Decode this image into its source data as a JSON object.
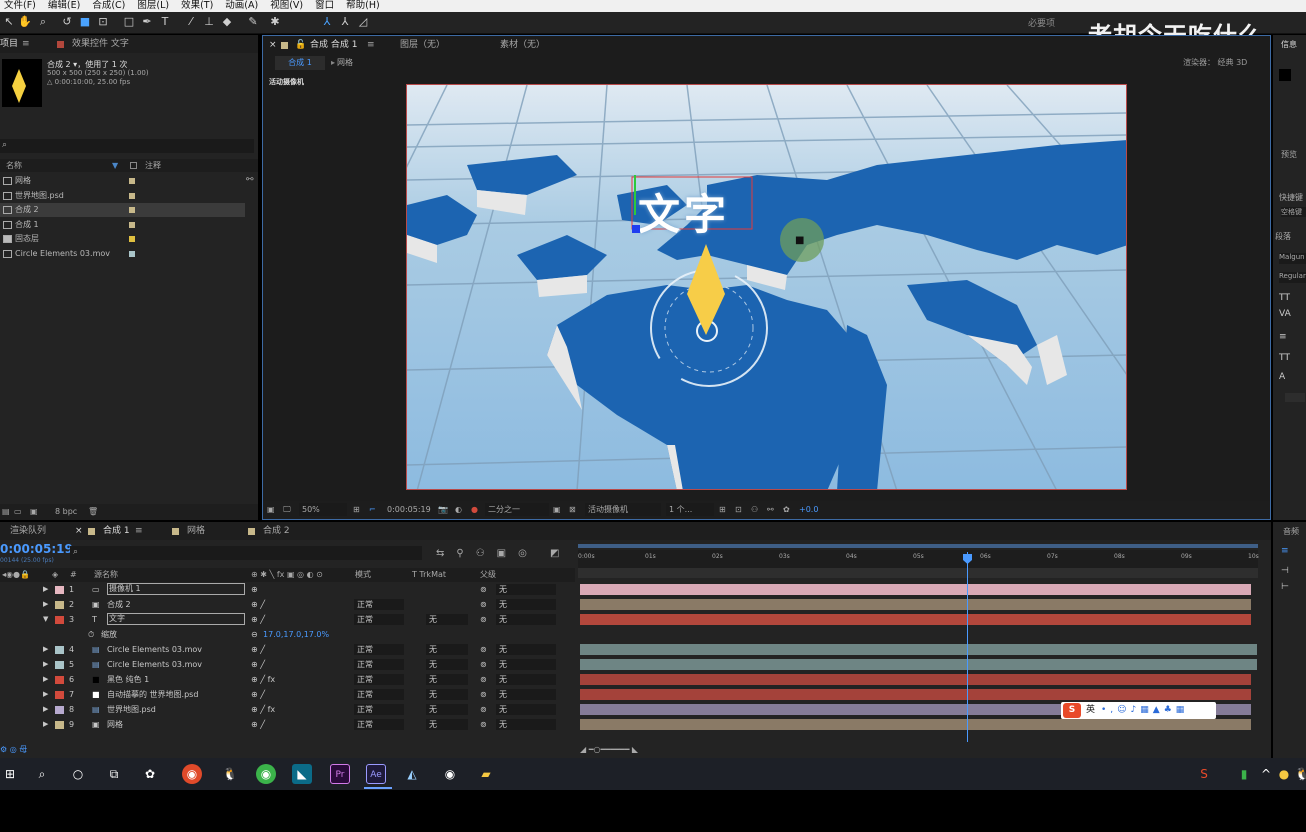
{
  "menu": [
    "文件(F)",
    "编辑(E)",
    "合成(C)",
    "图层(L)",
    "效果(T)",
    "动画(A)",
    "视图(V)",
    "窗口",
    "帮助(H)"
  ],
  "toolbar": {
    "workspace": "必要项",
    "icons": [
      "arrow-icon",
      "hand-icon",
      "zoom-icon",
      "rotate-icon",
      "camera-icon",
      "pan-behind-icon",
      "rect-icon",
      "pen-icon",
      "type-icon",
      "brush-icon",
      "stamp-icon",
      "eraser-icon",
      "roto-icon",
      "puppet-icon"
    ]
  },
  "watermark": "老胡今天吃什么",
  "project": {
    "tab_project": "项目",
    "tab_effects": "效果控件 文字",
    "comp_name": "合成 2 ▾，使用了 1 次",
    "comp_size": "500 x 500 (250 x 250) (1.00)",
    "comp_dur": "△ 0:00:10:00, 25.00 fps",
    "col_name": "名称",
    "col_note": "注释",
    "bpc": "8 bpc",
    "items": [
      {
        "name": "网格",
        "color": "#c7b88a",
        "icon": "comp"
      },
      {
        "name": "世界地图.psd",
        "color": "#c7b88a",
        "icon": "file"
      },
      {
        "name": "合成 2",
        "color": "#c7b88a",
        "icon": "comp"
      },
      {
        "name": "合成 1",
        "color": "#c7b88a",
        "icon": "comp"
      },
      {
        "name": "固态层",
        "color": "#e0c040",
        "icon": "folder"
      },
      {
        "name": "Circle Elements 03.mov",
        "color": "#a9c4c8",
        "icon": "file"
      }
    ]
  },
  "viewer": {
    "tab_comp": "合成 合成 1",
    "tab_layer": "图层（无）",
    "tab_footage": "素材（无）",
    "sub_tab1": "合成 1",
    "sub_tab2": "网格",
    "renderer": "渲染器：  经典 3D",
    "camera_label": "活动摄像机",
    "overlay_text": "文字",
    "zoom": "50%",
    "timecode": "0:00:05:19",
    "resolution": "二分之一",
    "camera_view": "活动摄像机",
    "views": "1 个...",
    "exposure": "+0.0"
  },
  "timeline": {
    "tab_render": "渲染队列",
    "tab_comp1": "合成 1",
    "tab_grid": "网格",
    "tab_comp2": "合成 2",
    "timecode": "0:00:05:19",
    "frame_info": "00144 (25.00 fps)",
    "col_source": "源名称",
    "col_mode": "模式",
    "col_trkmat": "T  TrkMat",
    "col_parent": "父级",
    "ruler": [
      "0:00s",
      "01s",
      "02s",
      "03s",
      "04s",
      "05s",
      "06s",
      "07s",
      "08s",
      "09s",
      "10s"
    ],
    "scale_label": "缩放",
    "scale_value": "17.0,17.0,17.0%",
    "layers": [
      {
        "num": "1",
        "name": "摄像机 1",
        "color": "#e6b7c1",
        "icon": "cam",
        "mode": "",
        "trk": "",
        "parent": "无",
        "bar": "#d9a9b6",
        "boxed": true
      },
      {
        "num": "2",
        "name": "合成 2",
        "color": "#c7b88a",
        "icon": "comp",
        "mode": "正常",
        "trk": "",
        "parent": "无",
        "bar": "#8a7a66",
        "boxed": false
      },
      {
        "num": "3",
        "name": "文字",
        "color": "#d24a3c",
        "icon": "T",
        "mode": "正常",
        "trk": "无",
        "parent": "无",
        "bar": "#b2473c",
        "boxed": true
      },
      {
        "num": "4",
        "name": "Circle Elements 03.mov",
        "color": "#a9c4c8",
        "icon": "file",
        "mode": "正常",
        "trk": "无",
        "parent": "无",
        "bar": "#6e8584",
        "boxed": false
      },
      {
        "num": "5",
        "name": "Circle Elements 03.mov",
        "color": "#a9c4c8",
        "icon": "file",
        "mode": "正常",
        "trk": "无",
        "parent": "无",
        "bar": "#6e8584",
        "boxed": false
      },
      {
        "num": "6",
        "name": "黑色 纯色 1",
        "color": "#d24a3c",
        "icon": "solid",
        "mode": "正常",
        "trk": "无",
        "parent": "无",
        "bar": "#a4423a",
        "boxed": false
      },
      {
        "num": "7",
        "name": "自动描摹的 世界地图.psd",
        "color": "#d24a3c",
        "icon": "white",
        "mode": "正常",
        "trk": "无",
        "parent": "无",
        "bar": "#a4423a",
        "boxed": false
      },
      {
        "num": "8",
        "name": "世界地图.psd",
        "color": "#b7aacf",
        "icon": "file",
        "mode": "正常",
        "trk": "无",
        "parent": "无",
        "bar": "#857c98",
        "boxed": false
      },
      {
        "num": "9",
        "name": "网格",
        "color": "#c7b88a",
        "icon": "comp",
        "mode": "正常",
        "trk": "无",
        "parent": "无",
        "bar": "#8a7a66",
        "boxed": false
      }
    ]
  },
  "ime": {
    "label": "英"
  },
  "rightpanel": {
    "info": "信息",
    "preview": "预览",
    "shortcut": "快捷键",
    "shortcut_val": "空格键",
    "para": "段落",
    "font": "Malgun",
    "style": "Regular",
    "audio": "音频"
  },
  "taskbar": {
    "icons": [
      "windows-icon",
      "search-icon",
      "cortana-icon",
      "taskview-icon",
      "app-icon",
      "chrome-icon",
      "qq-icon",
      "wechat-icon",
      "photoshop-icon",
      "premiere-icon",
      "aftereffects-icon",
      "app2-icon",
      "record-icon",
      "folder-icon"
    ]
  }
}
